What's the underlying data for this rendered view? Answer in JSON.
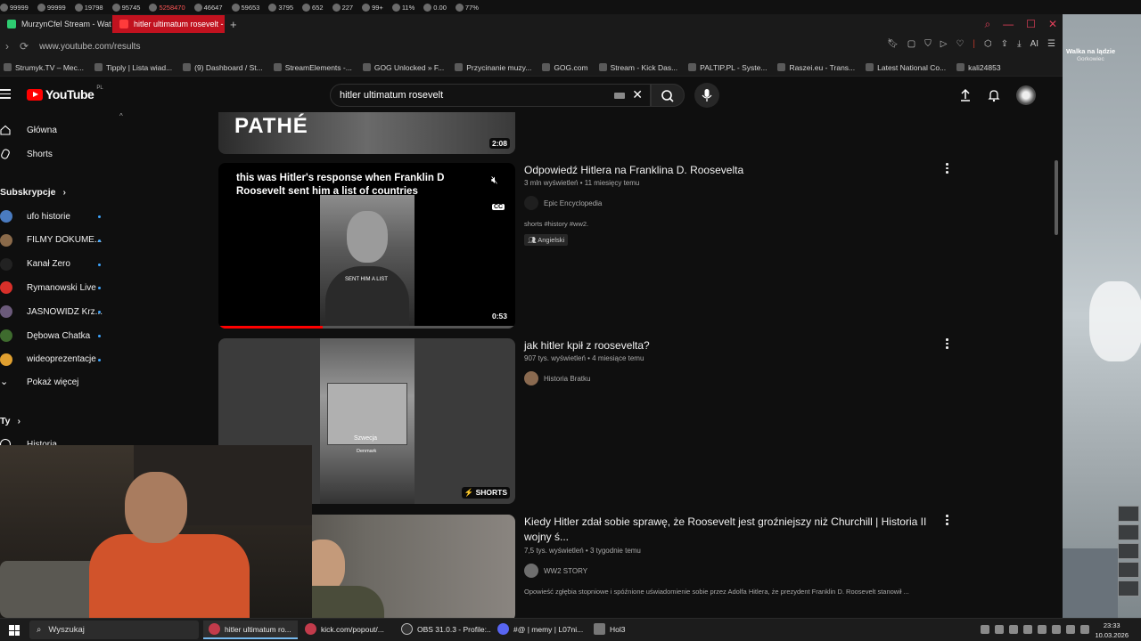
{
  "statbar": {
    "values": [
      "99999",
      "99999",
      "19798",
      "95745",
      "5258470",
      "46647",
      "59653",
      "3795",
      "652",
      "227",
      "99+",
      "11%",
      "0.00",
      "77%"
    ],
    "red_index": 4
  },
  "browser": {
    "tabs": [
      {
        "label": "MurzynCfel Stream - Wat"
      },
      {
        "label": "hitler ultimatum rosevelt -"
      }
    ],
    "url": "www.youtube.com/results",
    "bookmarks": [
      "Strumyk.TV – Mec...",
      "Tipply | Lista wiad...",
      "(9) Dashboard / St...",
      "StreamElements -...",
      "GOG Unlocked » F...",
      "Przycinanie muzy...",
      "GOG.com",
      "Stream - Kick Das...",
      "PALTIP.PL - Syste...",
      "Raszei.eu - Trans...",
      "Latest National Co...",
      "kali24853"
    ],
    "ai_label": "AI"
  },
  "youtube": {
    "logo": "YouTube",
    "country_code": "PL",
    "search_query": "hitler ultimatum rosevelt"
  },
  "sidebar": {
    "main": [
      {
        "label": "Główna",
        "icon": "home-icon"
      },
      {
        "label": "Shorts",
        "icon": "shorts-icon"
      }
    ],
    "subscriptions_heading": "Subskrypcje",
    "channels": [
      {
        "label": "ufo historie",
        "color": "#4a7bc0"
      },
      {
        "label": "FILMY DOKUME...",
        "color": "#8a6a4a"
      },
      {
        "label": "Kanał Zero",
        "color": "#222222"
      },
      {
        "label": "Rymanowski Live",
        "color": "#d8302a"
      },
      {
        "label": "JASNOWIDZ Krz...",
        "color": "#6b5a7a"
      },
      {
        "label": "Dębowa Chatka",
        "color": "#3e6b2e"
      },
      {
        "label": "wideoprezentacje",
        "color": "#e0a030"
      }
    ],
    "show_more": "Pokaż więcej",
    "you_heading": "Ty",
    "history": "Historia"
  },
  "results": [
    {
      "thumb_text": "PATHÉ",
      "duration": "2:08"
    },
    {
      "title": "Odpowiedź Hitlera na Franklina D. Roosevelta",
      "views": "3 mln wyświetleń",
      "age": "11 miesięcy temu",
      "channel": "Epic Encyclopedia",
      "description": "shorts #history #ww2.",
      "badge": "Angielski",
      "caption": "this was Hitler's response when Franklin D Roosevelt sent him a list of countries",
      "subtitle": "SENT HIM A LIST",
      "cc": "CC",
      "duration": "0:53",
      "progress": 0.35
    },
    {
      "title": "jak hitler kpił z roosevelta?",
      "views": "907 tys. wyświetleń",
      "age": "4 miesiące temu",
      "channel": "Historia Bratku",
      "subtitle_line1": "Szwecja",
      "subtitle_line2": "Denmark",
      "shorts_label": "SHORTS"
    },
    {
      "title": "Kiedy Hitler zdał sobie sprawę, że Roosevelt jest groźniejszy niż Churchill | Historia II wojny ś...",
      "views": "7,5 tys. wyświetleń",
      "age": "3 tygodnie temu",
      "channel": "WW2 STORY",
      "description": "Opowieść zgłębia stopniowe i spóźnione uświadomienie sobie przez Adolfa Hitlera, że prezydent Franklin D. Roosevelt stanowił ..."
    }
  ],
  "game": {
    "province": "Walka na lądzie",
    "subtitle": "Gorkowiec"
  },
  "taskbar": {
    "search": "Wyszukaj",
    "apps": [
      "hitler ultimatum ro...",
      "kick.com/popout/...",
      "OBS 31.0.3 - Profile:...",
      "#@ | memy | L07ni...",
      "Hol3"
    ],
    "time": "23:33",
    "date": "10.03.2026"
  }
}
